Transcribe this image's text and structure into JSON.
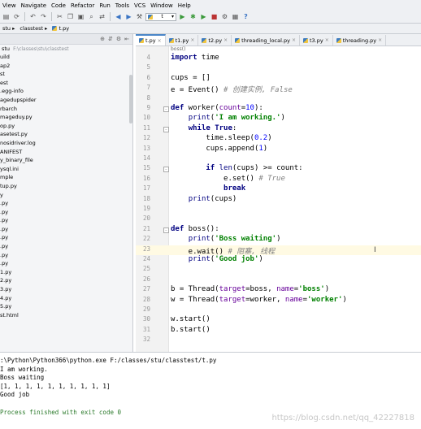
{
  "menu": [
    "View",
    "Navigate",
    "Code",
    "Refactor",
    "Run",
    "Tools",
    "VCS",
    "Window",
    "Help"
  ],
  "toolbar": {
    "run_config": "t"
  },
  "breadcrumb": [
    "stu",
    "classtest",
    "t.py"
  ],
  "sidebar": {
    "root_label": "stu",
    "root_path": "F:\\classes\\stu\\classtest",
    "items": [
      "uild",
      "ap2",
      "st",
      "est",
      ".egg-info",
      "agedupspider",
      "rbarch",
      "mageduy.py",
      "op.py",
      "asetest.py",
      "nosidriver.log",
      "ANIFEST",
      "y_binary_file",
      "ysql.ini",
      "mple",
      "tup.py",
      "y",
      ".py",
      ".py",
      ".py",
      ".py",
      ".py",
      ".py",
      ".py",
      ".py",
      "1.py",
      "2.py",
      "3.py",
      "4.py",
      "5.py",
      "st.html"
    ]
  },
  "tabs": [
    {
      "label": "t.py",
      "active": true
    },
    {
      "label": "t1.py",
      "active": false
    },
    {
      "label": "t2.py",
      "active": false
    },
    {
      "label": "threading_local.py",
      "active": false
    },
    {
      "label": "t3.py",
      "active": false
    },
    {
      "label": "threading.py",
      "active": false
    }
  ],
  "editor": {
    "crumb": "boss()",
    "lines": [
      {
        "n": "4",
        "t": "import time"
      },
      {
        "n": "5",
        "t": ""
      },
      {
        "n": "6",
        "t": "cups = []"
      },
      {
        "n": "7",
        "t": "e = Event() # 创建实例, False"
      },
      {
        "n": "8",
        "t": ""
      },
      {
        "n": "9",
        "t": "def worker(count=10):"
      },
      {
        "n": "10",
        "t": "    print('I am working.')"
      },
      {
        "n": "11",
        "t": "    while True:"
      },
      {
        "n": "12",
        "t": "        time.sleep(0.2)"
      },
      {
        "n": "13",
        "t": "        cups.append(1)"
      },
      {
        "n": "14",
        "t": ""
      },
      {
        "n": "15",
        "t": "        if len(cups) >= count:"
      },
      {
        "n": "16",
        "t": "            e.set() # True"
      },
      {
        "n": "17",
        "t": "            break"
      },
      {
        "n": "18",
        "t": "    print(cups)"
      },
      {
        "n": "19",
        "t": ""
      },
      {
        "n": "20",
        "t": ""
      },
      {
        "n": "21",
        "t": "def boss():"
      },
      {
        "n": "22",
        "t": "    print('Boss waiting')"
      },
      {
        "n": "23",
        "t": "    e.wait() # 阻塞, 线程"
      },
      {
        "n": "24",
        "t": "    print('Good job')"
      },
      {
        "n": "25",
        "t": ""
      },
      {
        "n": "26",
        "t": ""
      },
      {
        "n": "27",
        "t": "b = Thread(target=boss, name='boss')"
      },
      {
        "n": "28",
        "t": "w = Thread(target=worker, name='worker')"
      },
      {
        "n": "29",
        "t": ""
      },
      {
        "n": "30",
        "t": "w.start()"
      },
      {
        "n": "31",
        "t": "b.start()"
      },
      {
        "n": "32",
        "t": ""
      }
    ]
  },
  "console": {
    "lines": [
      ":\\Python\\Python366\\python.exe F:/classes/stu/classtest/t.py",
      "I am working.",
      "Boss waiting",
      "[1, 1, 1, 1, 1, 1, 1, 1, 1, 1]",
      "Good job",
      "",
      "Process finished with exit code 0"
    ]
  },
  "watermark": "https://blog.csdn.net/qq_42227818"
}
